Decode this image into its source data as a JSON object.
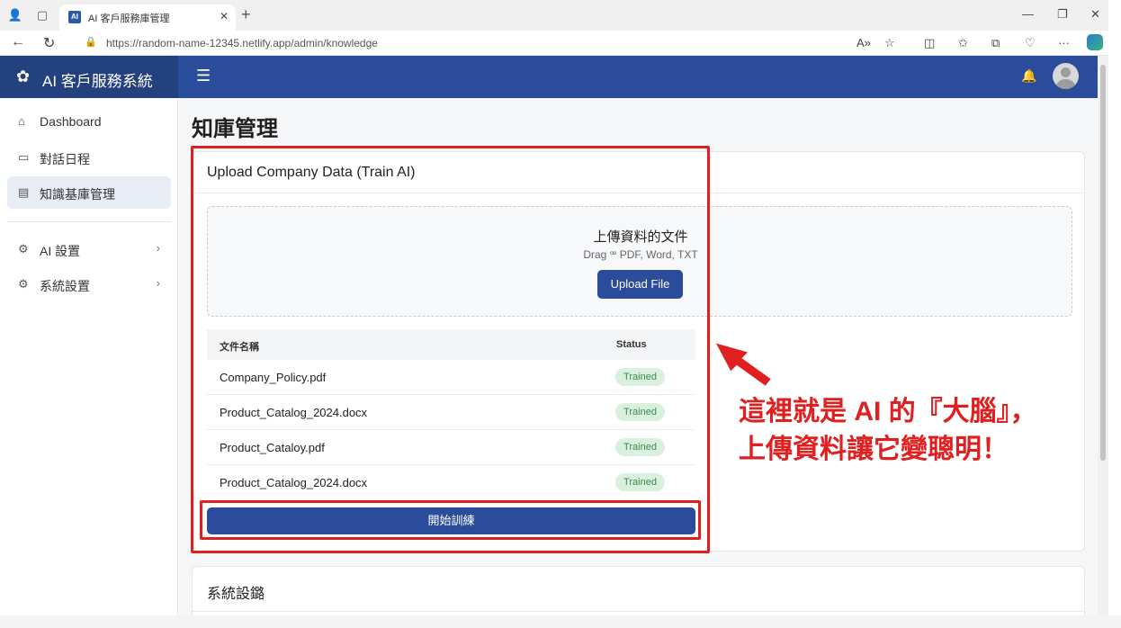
{
  "browser": {
    "tab_title": "AI 客戶服務庫管理",
    "url": "https://random-name-12345.netlify.app/admin/knowledge",
    "profile_icon": "person-icon",
    "reader_icon": "read-aloud-icon"
  },
  "app": {
    "brand": "AI 客戶服務系統",
    "brand_icon": "openai-knot-icon",
    "header_color": "#2b4c9b"
  },
  "sidebar": {
    "items": [
      {
        "label": "Dashboard",
        "icon": "home-icon",
        "active": false
      },
      {
        "label": "對話日程",
        "icon": "chat-icon",
        "active": false
      },
      {
        "label": "知識基庫管理",
        "icon": "book-icon",
        "active": true
      },
      {
        "label": "AI 設置",
        "icon": "gear-icon",
        "chevron": "›"
      },
      {
        "label": "系統設置",
        "icon": "gear-icon",
        "chevron": "›"
      }
    ]
  },
  "main": {
    "page_title": "知庫管理",
    "upload_card": {
      "title": "Upload Company Data (Train AI)",
      "dropzone_title": "上傳資料的文件",
      "dropzone_sub": "Drag ꟹ PDF, Word, TXT",
      "upload_button": "Upload File",
      "columns": {
        "name": "文件名稱",
        "status": "Status"
      },
      "files": [
        {
          "name": "Company_Policy.pdf",
          "status": "Trained"
        },
        {
          "name": "Product_Catalog_2024.docx",
          "status": "Trained"
        },
        {
          "name": "Product_Cataloy.pdf",
          "status": "Trained"
        },
        {
          "name": "Product_Catalog_2024.docx",
          "status": "Trained"
        }
      ],
      "train_button": "開始訓練"
    },
    "settings_card": {
      "title": "系統設鏴"
    }
  },
  "annotation": {
    "line1": "這裡就是 AI 的『大腦』，",
    "line2": "上傳資料讓它變聰明！",
    "color": "#e02020"
  }
}
